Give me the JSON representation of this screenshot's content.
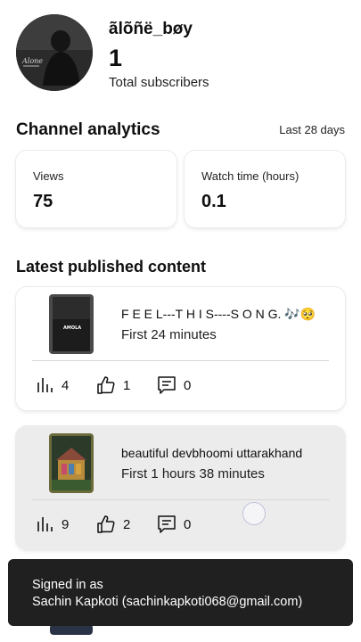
{
  "channel": {
    "name": "ãlõñë_bøy",
    "subscriber_count": "1",
    "subscriber_label": "Total subscribers",
    "avatar_text": "Alone"
  },
  "analytics": {
    "title": "Channel analytics",
    "period": "Last 28 days",
    "views_label": "Views",
    "views_value": "75",
    "watch_label": "Watch time (hours)",
    "watch_value": "0.1"
  },
  "latest": {
    "title": "Latest published content",
    "items": [
      {
        "title": "F E E L---T H I S----S O N G. 🎶🥺",
        "time": "First 24 minutes",
        "thumb_text": "AMOLA",
        "views": "4",
        "likes": "1",
        "comments": "0"
      },
      {
        "title": "beautiful devbhoomi uttarakhand",
        "time": "First 1 hours 38 minutes",
        "views": "9",
        "likes": "2",
        "comments": "0"
      }
    ]
  },
  "toast": {
    "line1": "Signed in as",
    "line2": "Sachin Kapkoti (sachinkapkoti068@gmail.com)"
  },
  "icons": {
    "views": "bar-chart-icon",
    "likes": "thumbs-up-icon",
    "comments": "comment-icon"
  },
  "colors": {
    "toast_bg": "#202020",
    "selected_card_bg": "#ececec"
  }
}
